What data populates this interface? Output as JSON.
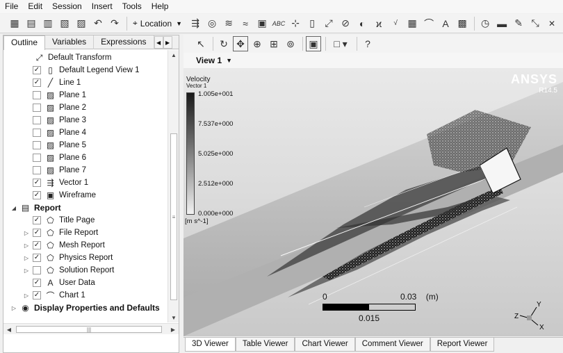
{
  "menu": [
    "File",
    "Edit",
    "Session",
    "Insert",
    "Tools",
    "Help"
  ],
  "toolbar": {
    "location_label": "Location",
    "icons_left": [
      "new-icon",
      "open-icon",
      "save-state-icon",
      "load-icon",
      "import-icon",
      "undo-icon",
      "redo-icon"
    ],
    "icons_right": [
      "vector-icon",
      "contour-icon",
      "streamline-icon",
      "volume-render-icon",
      "isosurface-icon",
      "text-icon",
      "coordinate-frame-icon",
      "legend-icon",
      "transform-icon",
      "clip-plane-icon",
      "color-map-icon",
      "variable-icon",
      "expression-icon",
      "table-icon",
      "chart-icon",
      "comment-icon",
      "figure-icon",
      "timestep-icon",
      "animation-icon",
      "quick-editor-icon",
      "probe-icon",
      "close-icon"
    ]
  },
  "left_panel": {
    "tabs": [
      "Outline",
      "Variables",
      "Expressions"
    ],
    "active_tab": "Outline",
    "tree": [
      {
        "label": "Default Transform",
        "icon": "transform-icon",
        "checkbox": false,
        "checked": false,
        "bold": false,
        "indent": 1
      },
      {
        "label": "Default Legend View 1",
        "icon": "legend-icon",
        "checkbox": true,
        "checked": true,
        "bold": false,
        "indent": 2
      },
      {
        "label": "Line 1",
        "icon": "line-icon",
        "checkbox": true,
        "checked": true,
        "bold": false,
        "indent": 2
      },
      {
        "label": "Plane 1",
        "icon": "plane-icon",
        "checkbox": true,
        "checked": false,
        "bold": false,
        "indent": 2
      },
      {
        "label": "Plane 2",
        "icon": "plane-icon",
        "checkbox": true,
        "checked": false,
        "bold": false,
        "indent": 2
      },
      {
        "label": "Plane 3",
        "icon": "plane-icon",
        "checkbox": true,
        "checked": false,
        "bold": false,
        "indent": 2
      },
      {
        "label": "Plane 4",
        "icon": "plane-icon",
        "checkbox": true,
        "checked": false,
        "bold": false,
        "indent": 2
      },
      {
        "label": "Plane 5",
        "icon": "plane-icon",
        "checkbox": true,
        "checked": false,
        "bold": false,
        "indent": 2
      },
      {
        "label": "Plane 6",
        "icon": "plane-icon",
        "checkbox": true,
        "checked": false,
        "bold": false,
        "indent": 2
      },
      {
        "label": "Plane 7",
        "icon": "plane-icon",
        "checkbox": true,
        "checked": false,
        "bold": false,
        "indent": 2
      },
      {
        "label": "Vector 1",
        "icon": "vector-icon",
        "checkbox": true,
        "checked": true,
        "bold": false,
        "indent": 2
      },
      {
        "label": "Wireframe",
        "icon": "wireframe-icon",
        "checkbox": true,
        "checked": true,
        "bold": false,
        "indent": 2
      },
      {
        "label": "Report",
        "icon": "report-icon",
        "checkbox": false,
        "checked": false,
        "bold": true,
        "indent": 0,
        "expander": "open"
      },
      {
        "label": "Title Page",
        "icon": "report-page-icon",
        "checkbox": true,
        "checked": true,
        "bold": false,
        "indent": 2
      },
      {
        "label": "File Report",
        "icon": "report-page-icon",
        "checkbox": true,
        "checked": true,
        "bold": false,
        "indent": 2,
        "expander": "closed"
      },
      {
        "label": "Mesh Report",
        "icon": "report-page-icon",
        "checkbox": true,
        "checked": true,
        "bold": false,
        "indent": 2,
        "expander": "closed"
      },
      {
        "label": "Physics Report",
        "icon": "report-page-icon",
        "checkbox": true,
        "checked": true,
        "bold": false,
        "indent": 2,
        "expander": "closed"
      },
      {
        "label": "Solution Report",
        "icon": "report-page-icon",
        "checkbox": true,
        "checked": false,
        "bold": false,
        "indent": 2,
        "expander": "closed"
      },
      {
        "label": "User Data",
        "icon": "text-icon",
        "checkbox": true,
        "checked": true,
        "bold": false,
        "indent": 2
      },
      {
        "label": "Chart 1",
        "icon": "chart-icon",
        "checkbox": true,
        "checked": true,
        "bold": false,
        "indent": 2,
        "expander": "closed"
      },
      {
        "label": "Display Properties and Defaults",
        "icon": "display-properties-icon",
        "checkbox": false,
        "checked": false,
        "bold": true,
        "indent": 0,
        "expander": "closed"
      }
    ]
  },
  "viewer_toolbar": {
    "icons": [
      "select-icon",
      "rotate-icon",
      "pan-icon",
      "zoom-icon",
      "zoom-box-icon",
      "fit-view-icon",
      "toggle-view-icon",
      "viewport-layout-icon",
      "help-icon"
    ]
  },
  "view": {
    "name": "View 1",
    "legend": {
      "title": "Velocity",
      "subtitle": "Vector 1",
      "ticks": [
        "1.005e+001",
        "7.537e+000",
        "5.025e+000",
        "2.512e+000",
        "0.000e+000"
      ],
      "unit": "[m s^-1]"
    },
    "brand": {
      "name": "ANSYS",
      "version": "R14.5"
    },
    "scale": {
      "zero": "0",
      "max": "0.03",
      "unit": "(m)",
      "mid": "0.015"
    },
    "axes": {
      "x": "X",
      "y": "Y",
      "z": "Z"
    }
  },
  "viewer_tabs": [
    "3D Viewer",
    "Table Viewer",
    "Chart Viewer",
    "Comment Viewer",
    "Report Viewer"
  ],
  "active_viewer_tab": "3D Viewer"
}
